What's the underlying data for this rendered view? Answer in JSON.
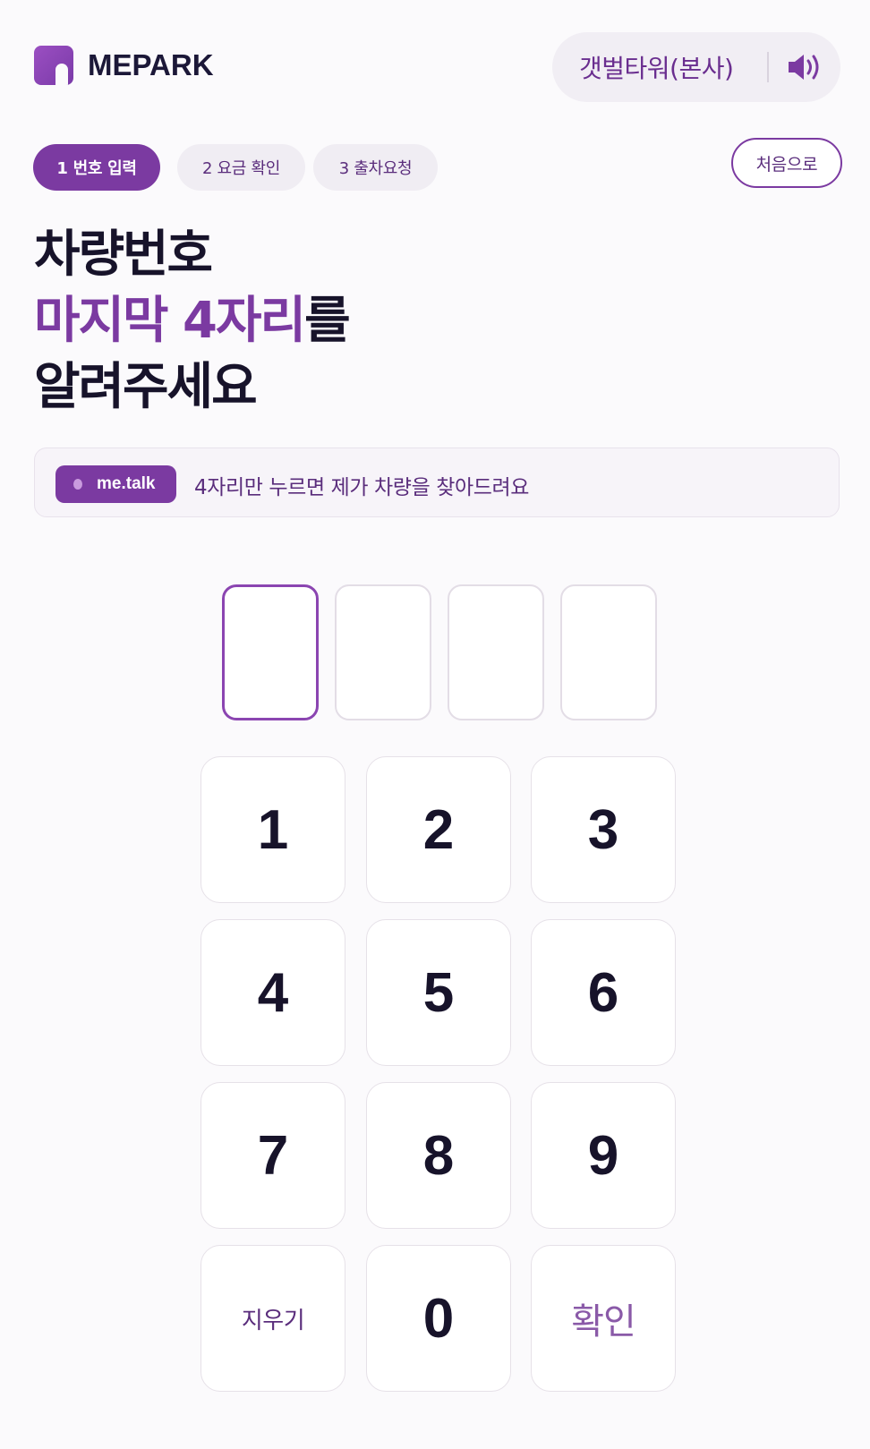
{
  "header": {
    "brand": "MEPARK",
    "location": "갯벌타워(본사)",
    "speaker_icon": "speaker-icon"
  },
  "steps": [
    {
      "label": "1 번호 입력",
      "active": true
    },
    {
      "label": "2 요금 확인",
      "active": false
    },
    {
      "label": "3 출차요청",
      "active": false
    }
  ],
  "home_button": "처음으로",
  "headline": {
    "line1": "차량번호",
    "line2_accent": "마지막 4자리",
    "line2_rest": "를",
    "line3": "알려주세요"
  },
  "talk": {
    "badge": "me.talk",
    "message": "4자리만 누르면 제가 차량을 찾아드려요"
  },
  "digits": [
    "",
    "",
    "",
    ""
  ],
  "keypad": {
    "keys": [
      "1",
      "2",
      "3",
      "4",
      "5",
      "6",
      "7",
      "8",
      "9"
    ],
    "clear": "지우기",
    "zero": "0",
    "confirm": "확인"
  },
  "colors": {
    "accent": "#7b3aa1",
    "background": "#fbfafc",
    "text": "#17132a"
  }
}
